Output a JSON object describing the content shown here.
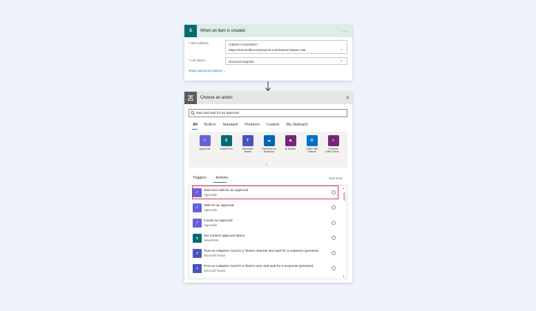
{
  "trigger": {
    "title": "When an item is created",
    "badge": "S",
    "fields": [
      {
        "label": "Site Address",
        "value_line1": "Adatum Corporation -",
        "value_line2": "https://microsofteur.sharepoint.com/teams/Adatum-AIB"
      },
      {
        "label": "List Name",
        "value_line1": "Discount requests"
      }
    ],
    "advanced_link": "Show advanced options",
    "required_mark": "*"
  },
  "action_panel": {
    "title": "Choose an action",
    "search": {
      "value": "start and wait for an approval"
    },
    "tabs": [
      "All",
      "Built-in",
      "Standard",
      "Premium",
      "Custom",
      "My clipboard"
    ],
    "connectors": [
      {
        "label": "Approvals",
        "color": "#6b5fdc",
        "icon": "approvals-icon",
        "glyph": "✓"
      },
      {
        "label": "SharePoint",
        "color": "#036c70",
        "icon": "sharepoint-icon",
        "glyph": "S"
      },
      {
        "label": "Microsoft Teams",
        "color": "#4b53bc",
        "icon": "teams-icon",
        "glyph": "T"
      },
      {
        "label": "OneDrive for Business",
        "color": "#0364b8",
        "icon": "onedrive-icon",
        "glyph": "☁"
      },
      {
        "label": "AI Builder",
        "color": "#742774",
        "icon": "ai-builder-icon",
        "glyph": "◈"
      },
      {
        "label": "Office 365 Outlook",
        "color": "#0072c6",
        "icon": "outlook-icon",
        "glyph": "O"
      },
      {
        "label": "Common Data Servic...",
        "color": "#742774",
        "icon": "database-icon",
        "glyph": "≡"
      }
    ],
    "subtabs": [
      "Triggers",
      "Actions"
    ],
    "see_more": "See more",
    "actions": [
      {
        "title": "Start and wait for an approval",
        "connector": "Approvals",
        "color": "#6b5fdc",
        "icon": "approvals-icon",
        "glyph": "✓",
        "selected": true
      },
      {
        "title": "Wait for an approval",
        "connector": "Approvals",
        "color": "#6b5fdc",
        "icon": "approvals-icon",
        "glyph": "✓",
        "selected": false
      },
      {
        "title": "Create an approval",
        "connector": "Approvals",
        "color": "#6b5fdc",
        "icon": "approvals-icon",
        "glyph": "✓",
        "selected": false
      },
      {
        "title": "Set content approval status",
        "connector": "SharePoint",
        "color": "#036c70",
        "icon": "sharepoint-icon",
        "glyph": "S",
        "selected": false
      },
      {
        "title": "Post an Adaptive Card to a Teams channel and wait for a response (preview)",
        "connector": "Microsoft Teams",
        "color": "#4b53bc",
        "icon": "teams-icon",
        "glyph": "T",
        "selected": false
      },
      {
        "title": "Post an Adaptive Card to a Teams user and wait for a response (preview)",
        "connector": "Microsoft Teams",
        "color": "#4b53bc",
        "icon": "teams-icon",
        "glyph": "T",
        "selected": false
      }
    ]
  },
  "colors": {
    "accent": "#0078d4",
    "selection": "#d13438",
    "trigger_header": "#dcece8"
  }
}
